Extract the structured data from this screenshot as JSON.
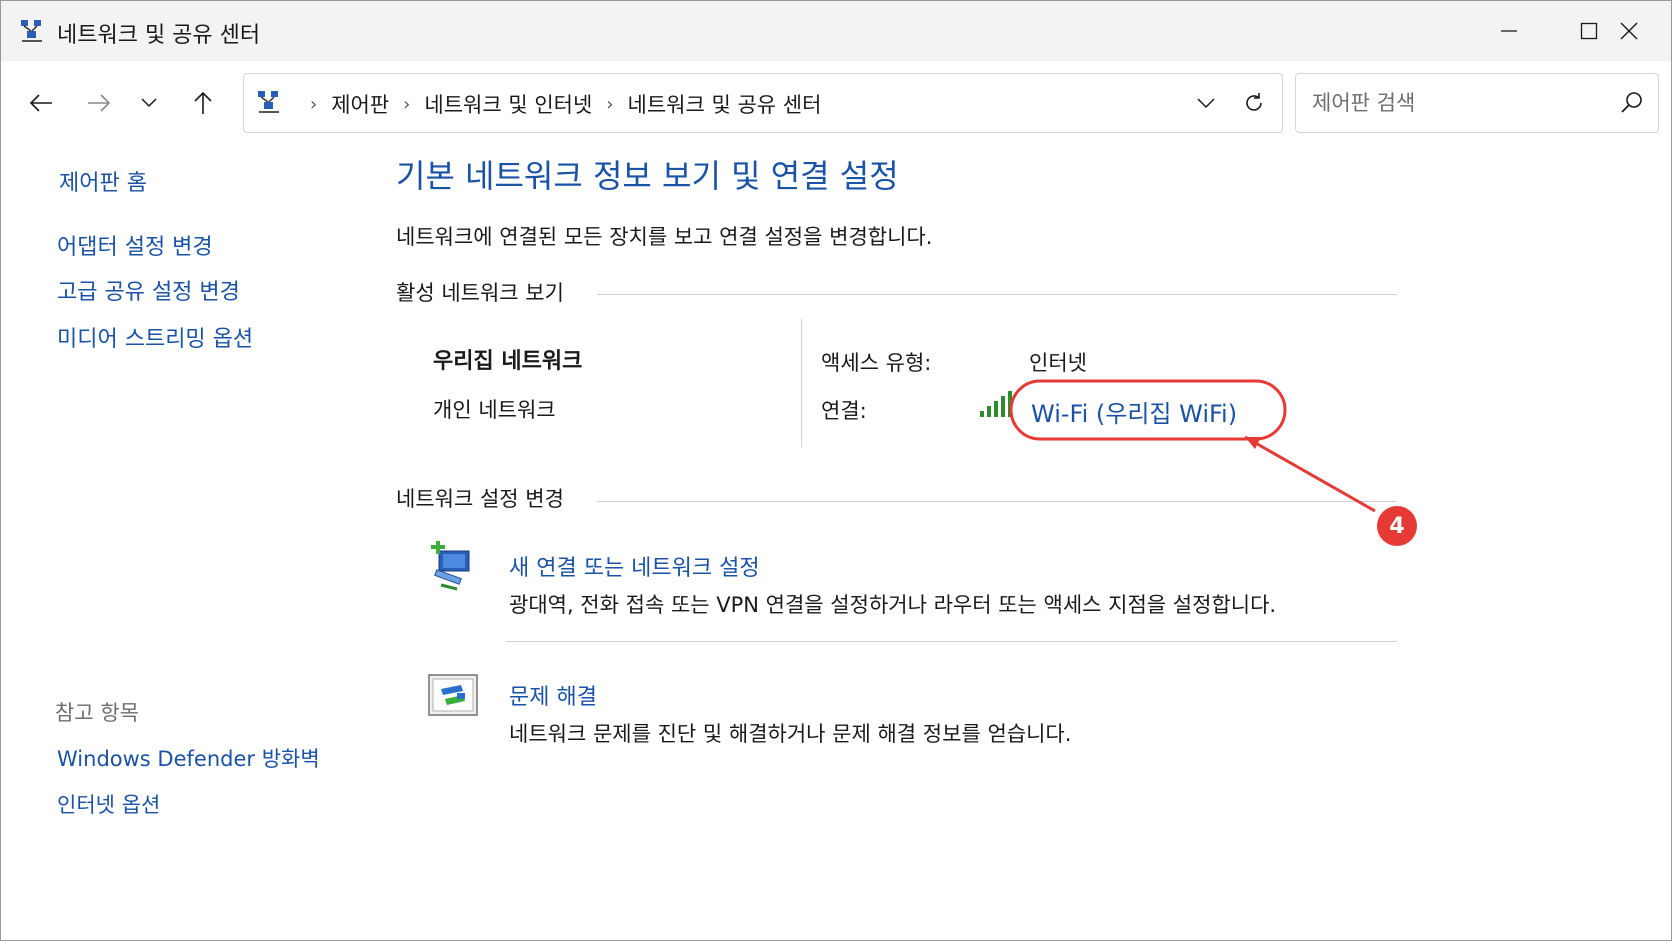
{
  "window": {
    "title": "네트워크 및 공유 센터"
  },
  "nav": {
    "breadcrumbs": [
      "제어판",
      "네트워크 및 인터넷",
      "네트워크 및 공유 센터"
    ],
    "search_placeholder": "제어판 검색"
  },
  "sidebar": {
    "links": [
      "제어판 홈",
      "어댑터 설정 변경",
      "고급 공유 설정 변경",
      "미디어 스트리밍 옵션"
    ],
    "see_also_header": "참고 항목",
    "see_also": [
      "Windows Defender 방화벽",
      "인터넷 옵션"
    ]
  },
  "main": {
    "title": "기본 네트워크 정보 보기 및 연결 설정",
    "subtitle": "네트워크에 연결된 모든 장치를 보고 연결 설정을 변경합니다.",
    "active_header": "활성 네트워크 보기",
    "network": {
      "name": "우리집 네트워크",
      "type": "개인 네트워크",
      "access_label": "액세스 유형:",
      "access_value": "인터넷",
      "connection_label": "연결:",
      "connection_value": "Wi-Fi (우리집 WiFi)"
    },
    "change_header": "네트워크 설정 변경",
    "tasks": [
      {
        "title": "새 연결 또는 네트워크 설정",
        "desc": "광대역, 전화 접속 또는 VPN 연결을 설정하거나 라우터 또는 액세스 지점을 설정합니다."
      },
      {
        "title": "문제 해결",
        "desc": "네트워크 문제를 진단 및 해결하거나 문제 해결 정보를 얻습니다."
      }
    ]
  },
  "annotation": {
    "badge_number": "4",
    "color": "#e53a35"
  },
  "colors": {
    "link": "#1a52a5",
    "signal": "#2e8b2e"
  }
}
